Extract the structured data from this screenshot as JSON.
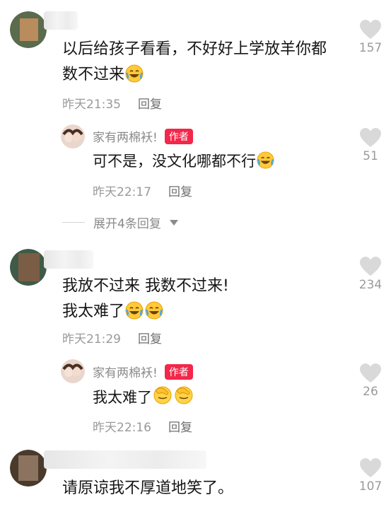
{
  "comments": [
    {
      "text": "以后给孩子看看，不好好上学放羊你都数不过来",
      "time": "昨天21:35",
      "reply_label": "回复",
      "likes": "157",
      "reply": {
        "author": "家有两棉袄!",
        "badge": "作者",
        "text": "可不是，没文化哪都不行",
        "time": "昨天22:17",
        "reply_label": "回复",
        "likes": "51"
      },
      "expand_label": "展开4条回复"
    },
    {
      "text_line1": "我放不过来 我数不过来!",
      "text_line2": "我太难了",
      "time": "昨天21:29",
      "reply_label": "回复",
      "likes": "234",
      "reply": {
        "author": "家有两棉袄!",
        "badge": "作者",
        "text": "我太难了",
        "time": "昨天22:16",
        "reply_label": "回复",
        "likes": "26"
      }
    },
    {
      "text": "请原谅我不厚道地笑了。",
      "likes": "107"
    }
  ],
  "icons": {
    "like": "heart-icon",
    "expand": "caret-down-icon",
    "laugh": "laugh-cry-emoji",
    "facepalm": "facepalm-emoji"
  },
  "colors": {
    "badge": "#f2274a",
    "meta": "#9a9a9a",
    "heart": "#d9d9d9"
  }
}
